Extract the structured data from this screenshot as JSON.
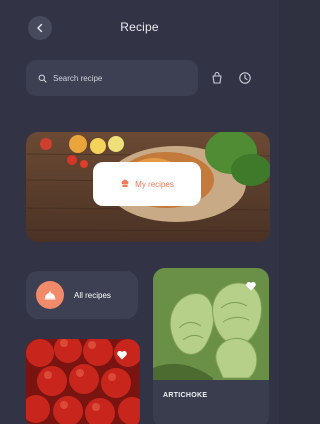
{
  "header": {
    "title": "Recipe"
  },
  "search": {
    "placeholder": "Search recipe"
  },
  "hero": {
    "button_label": "My recipes"
  },
  "all_recipes": {
    "label": "All recipes"
  },
  "cards": [
    {
      "name": "ARTICHOKE"
    },
    {
      "name": ""
    }
  ],
  "colors": {
    "background": "#323445",
    "card": "#3d4052",
    "accent": "#f07a5a"
  }
}
